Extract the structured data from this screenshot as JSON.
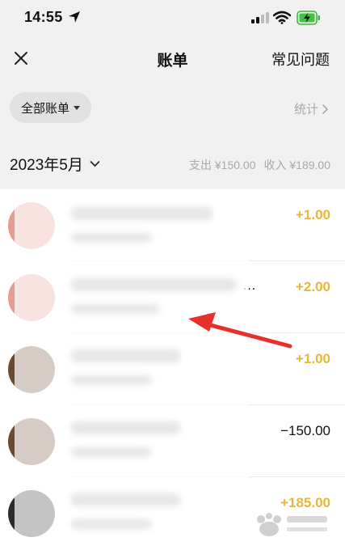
{
  "status": {
    "time": "14:55"
  },
  "nav": {
    "title": "账单",
    "faq": "常见问题"
  },
  "filter": {
    "label": "全部账单",
    "stats": "统计"
  },
  "month": {
    "label": "2023年5月",
    "expense": "支出 ¥150.00",
    "income": "收入 ¥189.00"
  },
  "transactions": [
    {
      "amount": "+1.00",
      "overflow": "",
      "avatar_color": "#e79b92"
    },
    {
      "amount": "+2.00",
      "overflow": "…",
      "avatar_color": "#e79b92"
    },
    {
      "amount": "+1.00",
      "overflow": "",
      "avatar_color": "#6b4a30"
    },
    {
      "amount": "−150.00",
      "overflow": "",
      "avatar_color": "#6b4a30"
    },
    {
      "amount": "+185.00",
      "overflow": "",
      "avatar_color": "#2b2b2b"
    }
  ],
  "colors": {
    "income_amount": "#e6b73a",
    "expense_amount": "#111111",
    "annotation_arrow": "#e8302b"
  }
}
